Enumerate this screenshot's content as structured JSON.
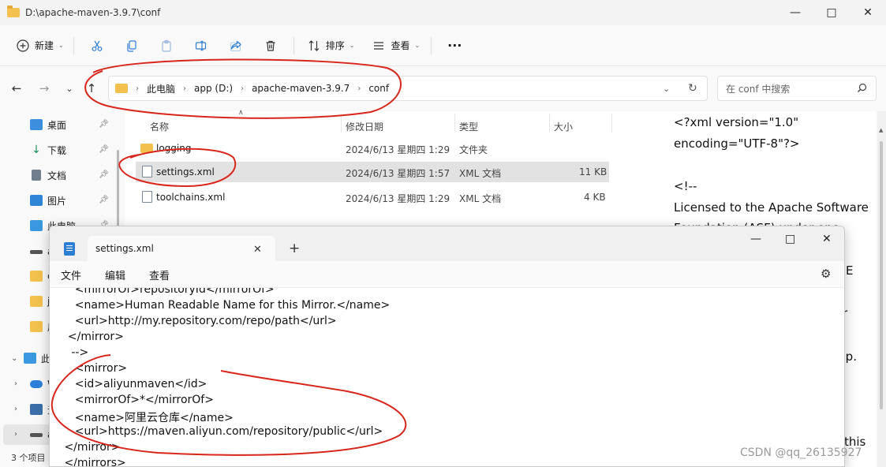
{
  "explorer": {
    "title": "D:\\apache-maven-3.9.7\\conf",
    "toolbar": {
      "new_label": "新建",
      "sort_label": "排序",
      "view_label": "查看",
      "more_label": "···"
    },
    "address": {
      "crumbs": [
        "此电脑",
        "app (D:)",
        "apache-maven-3.9.7",
        "conf"
      ]
    },
    "search_placeholder": "在 conf 中搜索",
    "columns": [
      "名称",
      "修改日期",
      "类型",
      "大小"
    ],
    "files": [
      {
        "name": "logging",
        "modified": "2024/6/13 星期四 1:29",
        "type": "文件夹",
        "size": ""
      },
      {
        "name": "settings.xml",
        "modified": "2024/6/13 星期四 1:57",
        "type": "XML 文档",
        "size": "11 KB"
      },
      {
        "name": "toolchains.xml",
        "modified": "2024/6/13 星期四 1:29",
        "type": "XML 文档",
        "size": "4 KB"
      }
    ],
    "sidebar": {
      "items": [
        "桌面",
        "下载",
        "文档",
        "图片",
        "此电脑",
        "a",
        "c",
        "j",
        "房",
        "此",
        "W",
        "无",
        "a"
      ]
    },
    "status": "3 个项目",
    "preview": {
      "lines": [
        "<?xml version=\"1.0\"",
        "encoding=\"UTF-8\"?>",
        "",
        "<!--",
        "Licensed to the Apache Software",
        "Foundation (ASF) under one",
        "E",
        "r",
        "hip.",
        "this"
      ]
    }
  },
  "notepad": {
    "tab_title": "settings.xml",
    "menus": [
      "文件",
      "编辑",
      "查看"
    ],
    "lines": [
      "    <mirrorOf>repositoryId</mirrorOf>",
      "    <name>Human Readable Name for this Mirror.</name>",
      "    <url>http://my.repository.com/repo/path</url>",
      "  </mirror>",
      "   -->",
      "    <mirror>",
      "    <id>aliyunmaven</id>",
      "    <mirrorOf>*</mirrorOf>",
      "    <name>阿里云仓库</name>",
      "    <url>https://maven.aliyun.com/repository/public</url>",
      " </mirror>",
      " </mirrors>"
    ]
  },
  "watermark": "CSDN @qq_26135927",
  "colors": {
    "annotation": "#d9261c",
    "selection": "#e2e2e2",
    "accent": "#2e7dd6"
  }
}
